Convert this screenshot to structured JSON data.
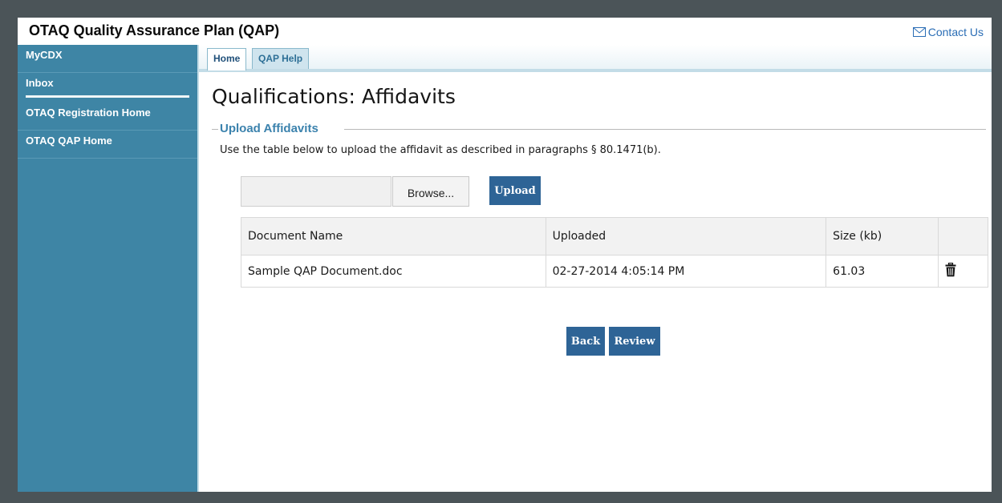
{
  "app": {
    "title": "OTAQ Quality Assurance Plan (QAP)",
    "contact_label": "Contact Us"
  },
  "sidebar": {
    "items": [
      {
        "label": "MyCDX"
      },
      {
        "label": "Inbox"
      },
      {
        "label": "OTAQ Registration Home"
      },
      {
        "label": "OTAQ QAP Home"
      }
    ]
  },
  "tabs": [
    {
      "label": "Home",
      "active": true
    },
    {
      "label": "QAP Help",
      "active": false
    }
  ],
  "main": {
    "page_title": "Qualifications: Affidavits",
    "section_legend": "Upload Affidavits",
    "instructions": "Use the table below to upload the affidavit as described in paragraphs § 80.1471(b).",
    "file_input_value": "",
    "browse_label": "Browse...",
    "upload_label": "Upload",
    "table": {
      "columns": [
        "Document Name",
        "Uploaded",
        "Size (kb)",
        ""
      ],
      "rows": [
        {
          "name": "Sample QAP Document.doc",
          "uploaded": "02-27-2014 4:05:14 PM",
          "size": "61.03",
          "action_icon": "trash-icon"
        }
      ]
    },
    "back_label": "Back",
    "review_label": "Review"
  },
  "colors": {
    "sidebar": "#3e85a5",
    "button": "#2e6496",
    "legend": "#3b82ad",
    "link": "#2a6db5",
    "outer_frame": "#4b5458"
  }
}
